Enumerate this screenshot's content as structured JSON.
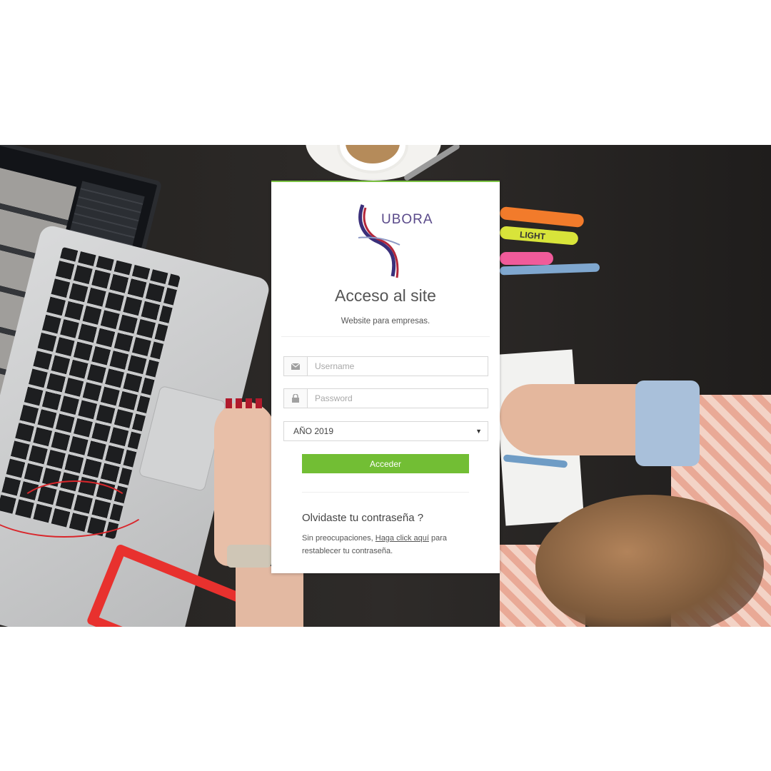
{
  "login": {
    "logo_text": "UBORA",
    "title": "Acceso al site",
    "subtitle": "Website para empresas.",
    "username_placeholder": "Username",
    "password_placeholder": "Password",
    "year_select": {
      "selected": "AÑO 2019"
    },
    "submit_label": "Acceder",
    "forgot_title": "Olvidaste tu contraseña ?",
    "help_prefix": "Sin preocupaciones,",
    "help_link": "Haga click aquí",
    "help_suffix": "para restablecer tu contraseña.",
    "accent_color": "#72be34"
  },
  "background": {
    "highlighter_label": "LIGHT"
  },
  "icons": {
    "username": "envelope-icon",
    "password": "lock-icon",
    "select": "caret-down-icon"
  }
}
